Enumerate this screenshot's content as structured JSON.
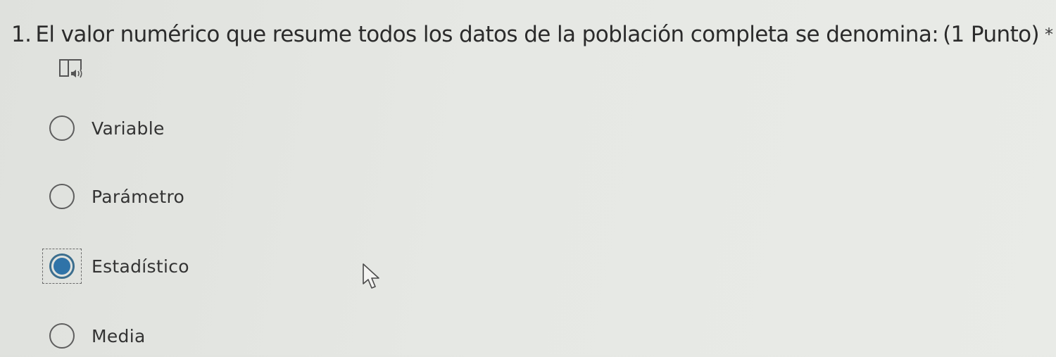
{
  "question": {
    "number": "1.",
    "text": "El valor numérico que resume todos los datos de la población completa se denomina:",
    "points": "(1 Punto)",
    "required_marker": "*"
  },
  "reader_icon": "immersive-reader-icon",
  "options": [
    {
      "label": "Variable",
      "selected": false
    },
    {
      "label": "Parámetro",
      "selected": false
    },
    {
      "label": "Estadístico",
      "selected": true
    },
    {
      "label": "Media",
      "selected": false
    }
  ],
  "colors": {
    "radio_selected": "#2f73a8",
    "radio_border": "#5e5e5e",
    "text": "#333333"
  },
  "cursor_icon": "mouse-pointer-icon"
}
